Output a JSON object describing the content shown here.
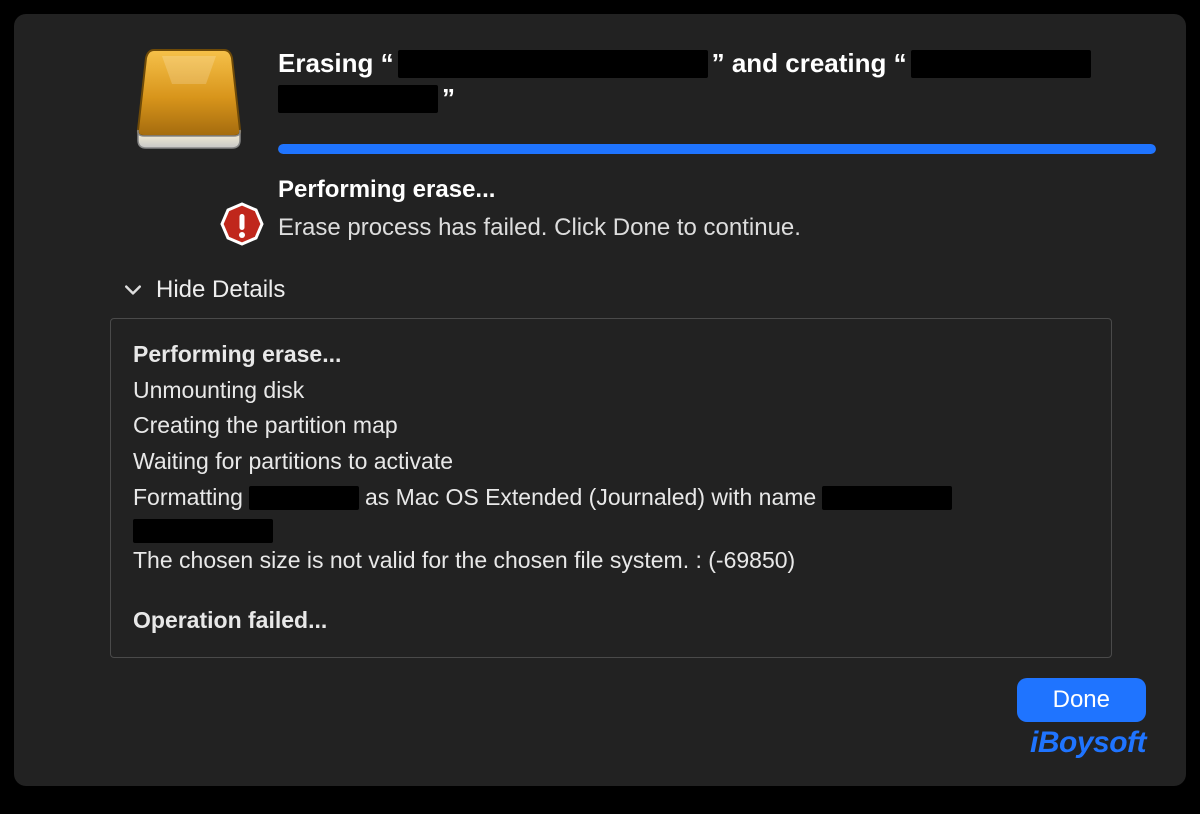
{
  "title": {
    "prefix": "Erasing “",
    "mid": "” and creating “",
    "suffix": "”"
  },
  "progress_percent": 100,
  "status": {
    "heading": "Performing erase...",
    "sub": "Erase process has failed. Click Done to continue."
  },
  "details_toggle_label": "Hide Details",
  "log": {
    "l1": "Performing erase...",
    "l2": "Unmounting disk",
    "l3": "Creating the partition map",
    "l4": "Waiting for partitions to activate",
    "l5a": "Formatting",
    "l5b": "as Mac OS Extended (Journaled) with name",
    "l6": "The chosen size is not valid for the chosen file system. : (-69850)",
    "l7": "Operation failed..."
  },
  "done_label": "Done",
  "watermark": "iBoysoft"
}
